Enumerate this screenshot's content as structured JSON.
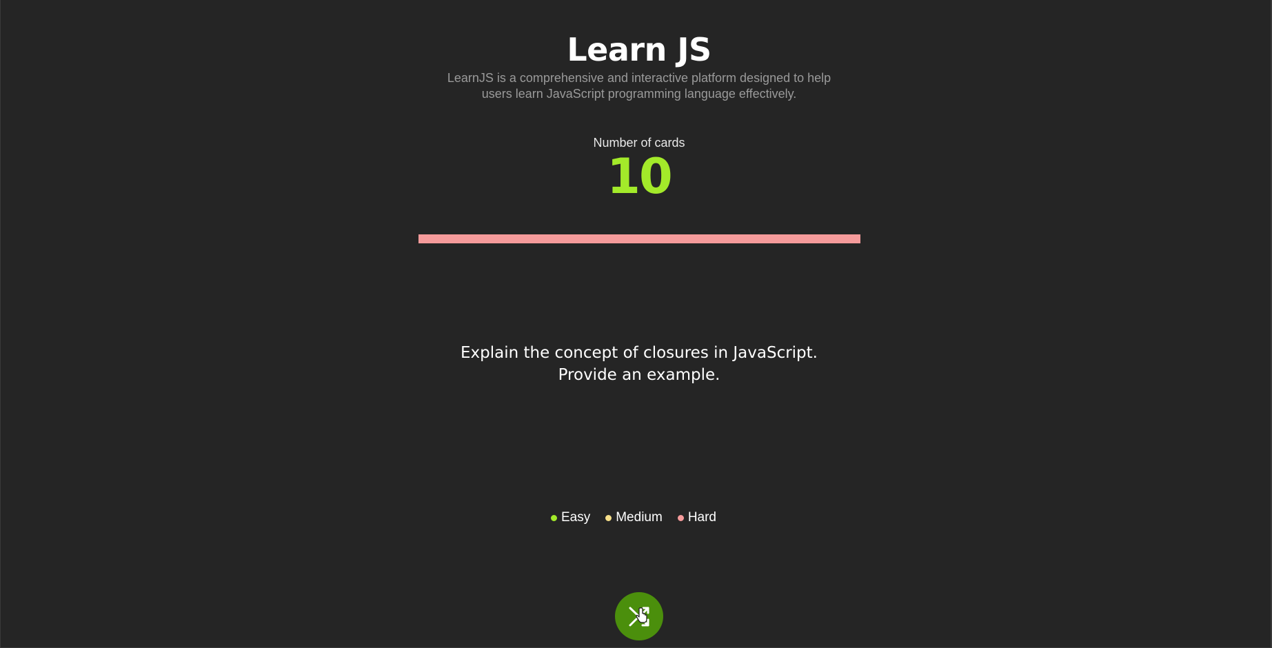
{
  "header": {
    "title": "Learn JS",
    "subtitle": "LearnJS is a comprehensive and interactive platform designed to help users learn JavaScript programming language effectively."
  },
  "counter": {
    "label": "Number of cards",
    "value": "10"
  },
  "progress": {
    "fraction": 1.0,
    "color": "#f59b9b"
  },
  "card": {
    "question_line1": "Explain the concept of closures in JavaScript.",
    "question_line2": "Provide an example."
  },
  "legend": {
    "items": [
      {
        "label": "Easy",
        "color": "#a3ea2a"
      },
      {
        "label": "Medium",
        "color": "#f7e08a"
      },
      {
        "label": "Hard",
        "color": "#f59b9b"
      }
    ]
  },
  "shuffle_button": {
    "icon": "shuffle-icon",
    "color": "#4b8f0c"
  }
}
